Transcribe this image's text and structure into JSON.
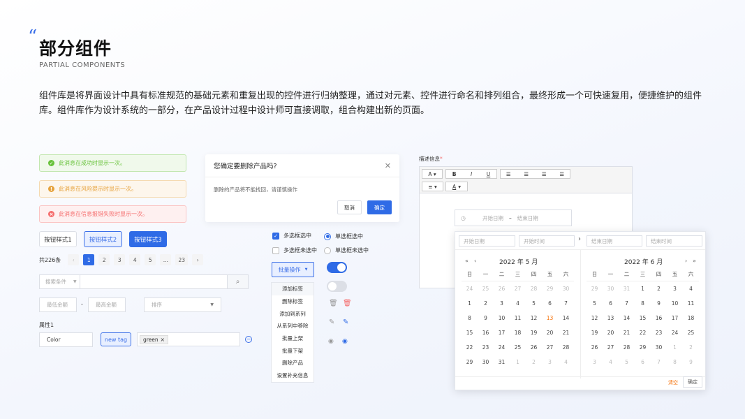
{
  "header": {
    "quote_mark": "“",
    "title": "部分组件",
    "subtitle": "PARTIAL COMPONENTS",
    "description": "组件库是将界面设计中具有标准规范的基础元素和重复出现的控件进行归纳整理，通过对元素、控件进行命名和排列组合，最终形成一个可快速复用，便捷维护的组件库。组件库作为设计系统的一部分，在产品设计过程中设计师可直接调取，组合构建出新的页面。"
  },
  "messages": {
    "success": "此消息在成功时显示一次。",
    "warning": "此消息在风险提示时显示一次。",
    "error": "此消息在信息报错失败时显示一次。"
  },
  "buttons": {
    "style1": "按钮样式1",
    "style2": "按钮样式2",
    "style3": "按钮样式3"
  },
  "pagination": {
    "total": "共226条",
    "pages": [
      "1",
      "2",
      "3",
      "4",
      "5",
      "...",
      "23"
    ],
    "current": "1"
  },
  "search": {
    "condition_placeholder": "搜索条件",
    "input_placeholder": ""
  },
  "range": {
    "min_placeholder": "最低金额",
    "separator": "-",
    "max_placeholder": "最高金额",
    "sort_placeholder": "排序"
  },
  "attributes": {
    "label": "属性1",
    "color_value": "Color",
    "new_tag": "new tag",
    "tag": "green"
  },
  "dialog": {
    "title": "您确定要删除产品吗?",
    "body": "删除的产品将不能找回，请谨慎操作",
    "cancel": "取消",
    "confirm": "确定"
  },
  "checkboxes": {
    "checked": "多选框选中",
    "unchecked": "多选框未选中"
  },
  "radios": {
    "checked": "单选框选中",
    "unchecked": "单选框未选中"
  },
  "batch": {
    "label": "批量操作",
    "items": [
      "添加标签",
      "删除标签",
      "添加到系列",
      "从系列中移除",
      "批量上架",
      "批量下架",
      "删除产品",
      "设置补充信息"
    ]
  },
  "editor": {
    "label": "描述信息",
    "required_mark": "*"
  },
  "datepicker": {
    "start_date": "开始日期",
    "end_date": "结束日期",
    "start_date2": "开始日期",
    "start_time": "开始时间",
    "end_date2": "结束日期",
    "end_time": "结束时间",
    "left_month": "2022 年 5 月",
    "right_month": "2022 年 6 月",
    "weekdays": [
      "日",
      "一",
      "二",
      "三",
      "四",
      "五",
      "六"
    ],
    "left_days": [
      [
        "24",
        "25",
        "26",
        "27",
        "28",
        "29",
        "30"
      ],
      [
        "1",
        "2",
        "3",
        "4",
        "5",
        "6",
        "7"
      ],
      [
        "8",
        "9",
        "10",
        "11",
        "12",
        "13",
        "14"
      ],
      [
        "15",
        "16",
        "17",
        "18",
        "19",
        "20",
        "21"
      ],
      [
        "22",
        "23",
        "24",
        "25",
        "26",
        "27",
        "28"
      ],
      [
        "29",
        "30",
        "31",
        "1",
        "2",
        "3",
        "4"
      ]
    ],
    "right_days": [
      [
        "29",
        "30",
        "31",
        "1",
        "2",
        "3",
        "4"
      ],
      [
        "5",
        "6",
        "7",
        "8",
        "9",
        "10",
        "11"
      ],
      [
        "12",
        "13",
        "14",
        "15",
        "16",
        "17",
        "18"
      ],
      [
        "19",
        "20",
        "21",
        "22",
        "23",
        "24",
        "25"
      ],
      [
        "26",
        "27",
        "28",
        "29",
        "30",
        "1",
        "2"
      ],
      [
        "3",
        "4",
        "5",
        "6",
        "7",
        "8",
        "9"
      ]
    ],
    "today": "13",
    "clear": "清空",
    "ok": "确定"
  },
  "colors": {
    "primary": "#2f6be6",
    "success": "#67c23a",
    "warning": "#e6a23c",
    "error": "#f56c6c",
    "today": "#f56c00"
  }
}
